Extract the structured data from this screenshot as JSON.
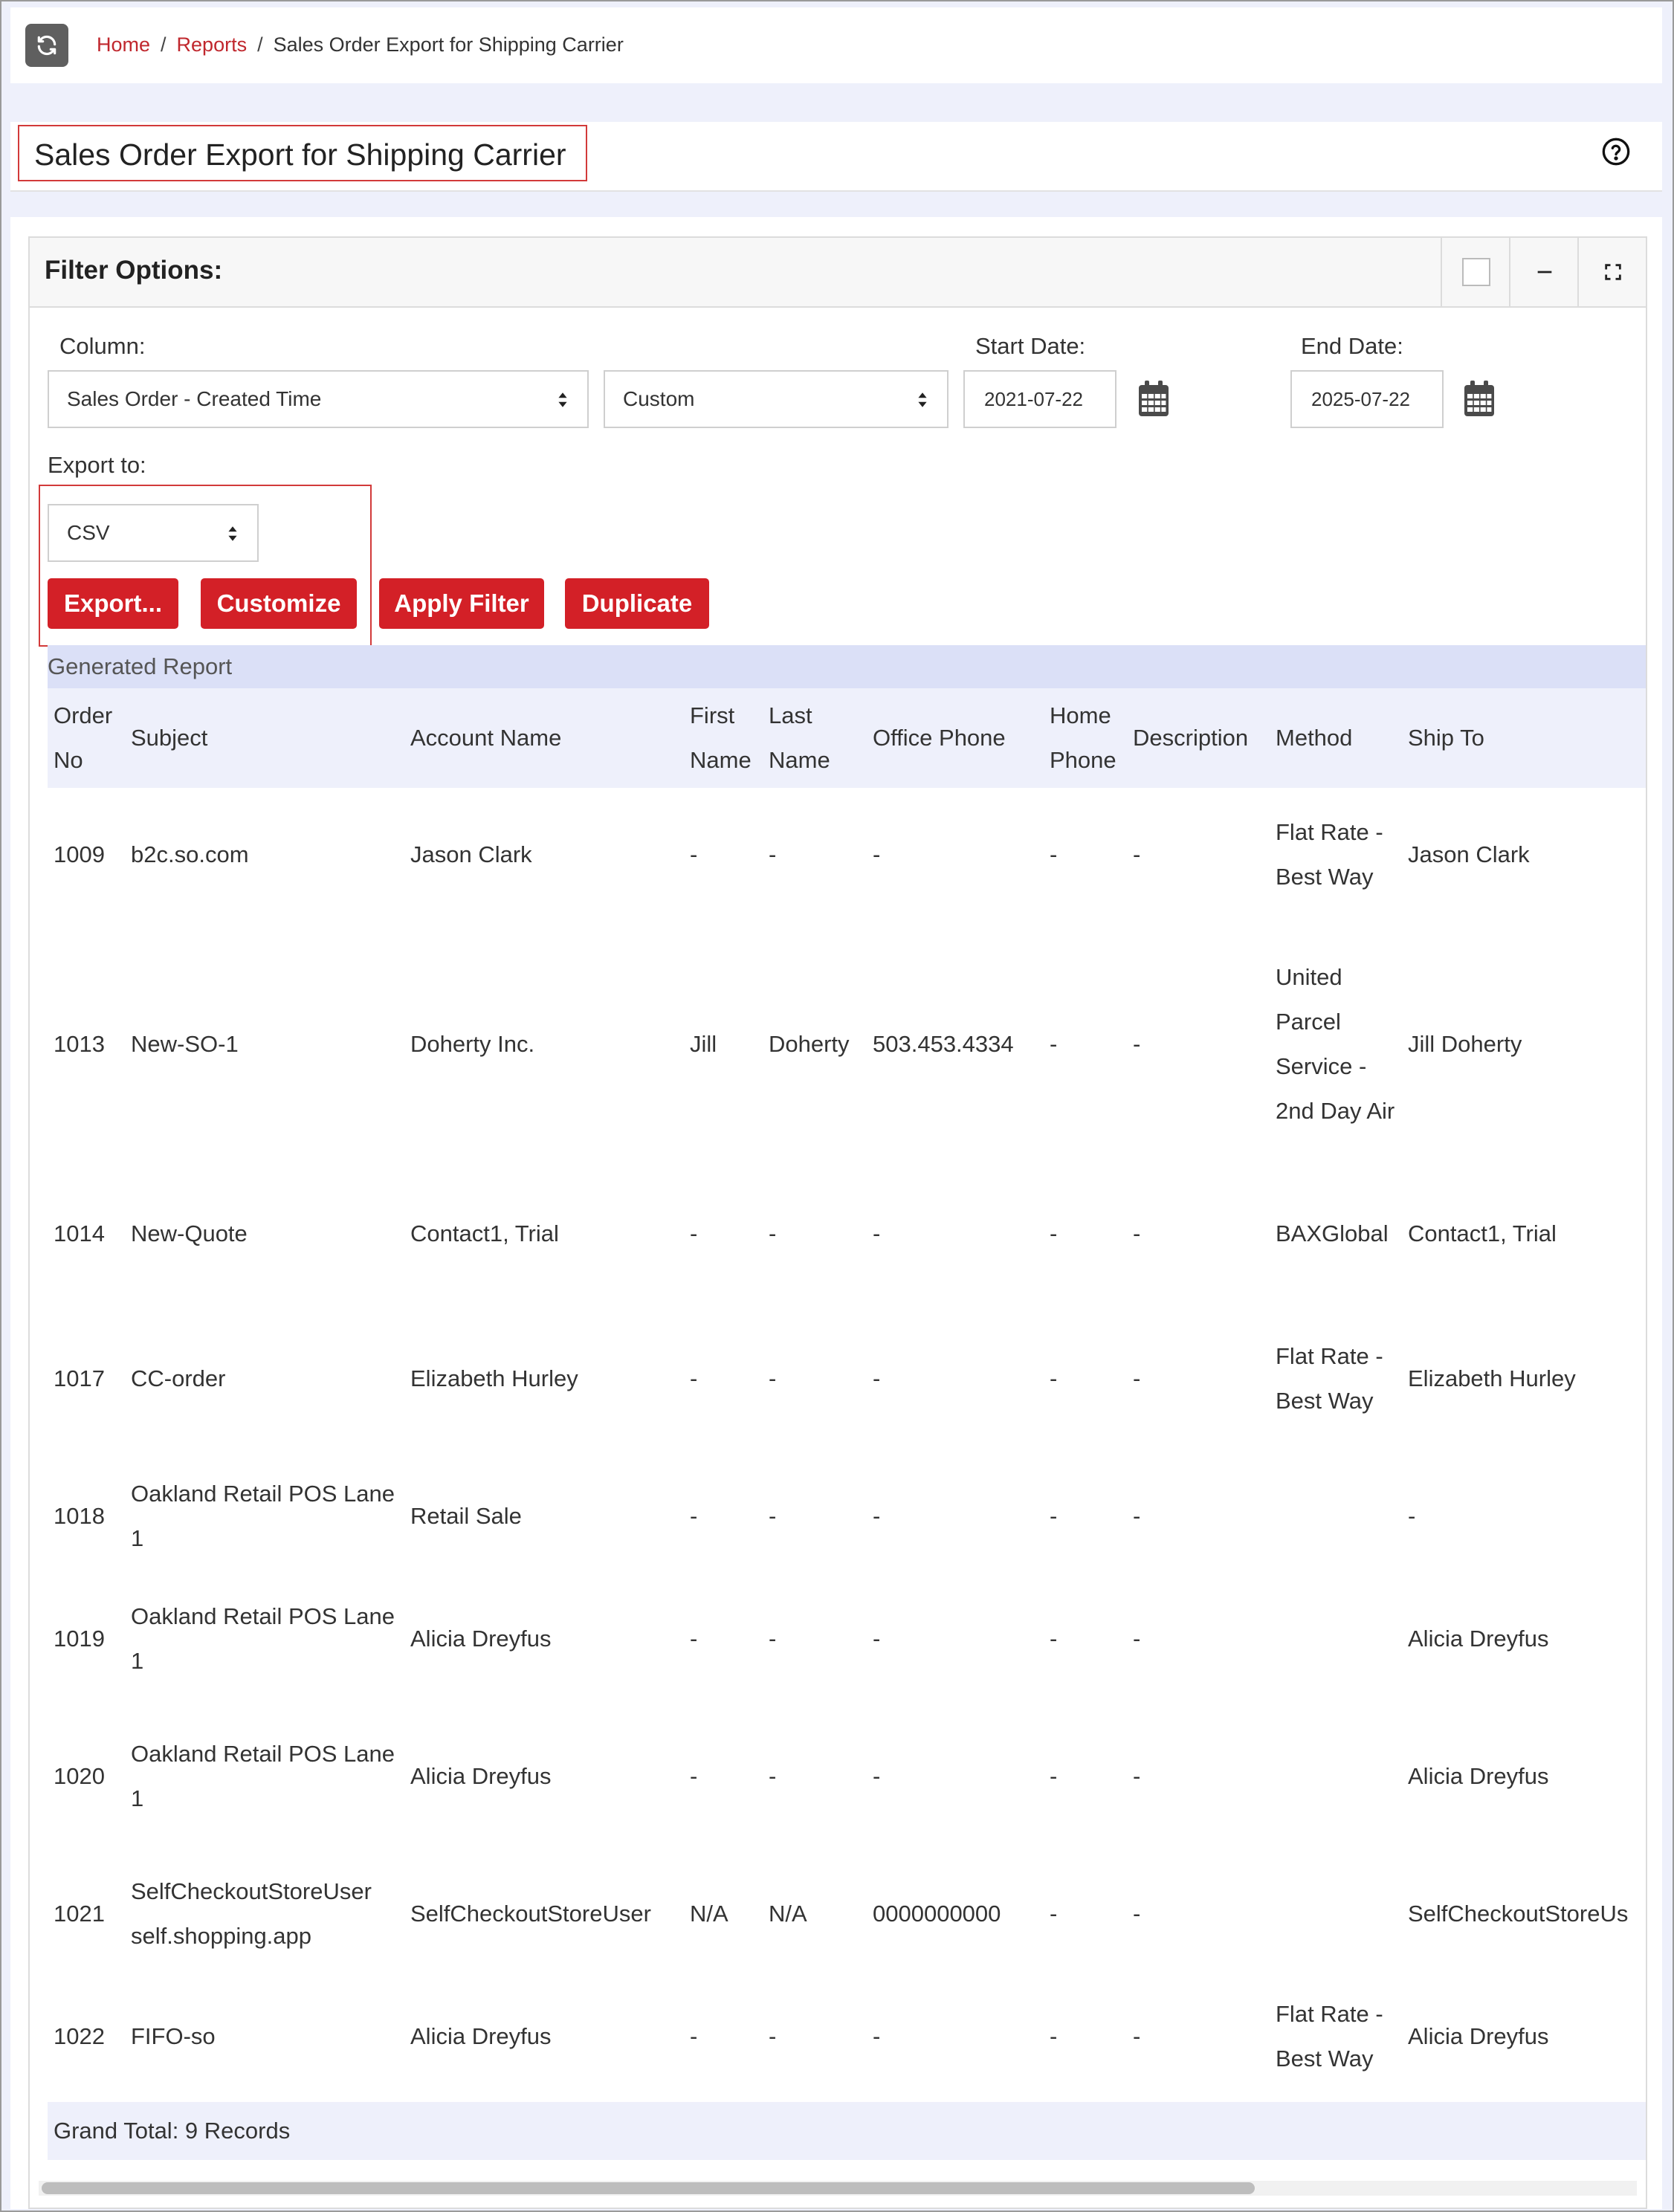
{
  "breadcrumb": {
    "items": [
      "Home",
      "Reports"
    ],
    "current": "Sales Order Export for Shipping Carrier",
    "separator": "/"
  },
  "page": {
    "title": "Sales Order Export for Shipping Carrier"
  },
  "filter_panel": {
    "title": "Filter Options:",
    "column_label": "Column:",
    "column_value": "Sales Order - Created Time",
    "range_value": "Custom",
    "start_label": "Start Date:",
    "start_value": "2021-07-22",
    "end_label": "End Date:",
    "end_value": "2025-07-22",
    "export_label": "Export to:",
    "export_value": "CSV",
    "buttons": {
      "export": "Export...",
      "customize": "Customize",
      "apply": "Apply Filter",
      "duplicate": "Duplicate"
    }
  },
  "report": {
    "section_title": "Generated Report",
    "columns": [
      "Order No",
      "Subject",
      "Account Name",
      "First Name",
      "Last Name",
      "Office Phone",
      "Home Phone",
      "Description",
      "Method",
      "Ship To"
    ],
    "rows": [
      [
        "1009",
        "b2c.so.com",
        "Jason Clark",
        "-",
        "-",
        "-",
        "-",
        "-",
        "Flat Rate - Best Way",
        "Jason Clark"
      ],
      [
        "1013",
        "New-SO-1",
        "Doherty Inc.",
        "Jill",
        "Doherty",
        "503.453.4334",
        "-",
        "-",
        "United Parcel Service - 2nd Day Air",
        "Jill Doherty"
      ],
      [
        "1014",
        "New-Quote",
        "Contact1, Trial",
        "-",
        "-",
        "-",
        "-",
        "-",
        "BAXGlobal",
        "Contact1, Trial"
      ],
      [
        "1017",
        "CC-order",
        "Elizabeth Hurley",
        "-",
        "-",
        "-",
        "-",
        "-",
        "Flat Rate - Best Way",
        "Elizabeth Hurley"
      ],
      [
        "1018",
        "Oakland Retail POS Lane 1",
        "Retail Sale",
        "-",
        "-",
        "-",
        "-",
        "-",
        "",
        "-"
      ],
      [
        "1019",
        "Oakland Retail POS Lane 1",
        "Alicia Dreyfus",
        "-",
        "-",
        "-",
        "-",
        "-",
        "",
        "Alicia Dreyfus"
      ],
      [
        "1020",
        "Oakland Retail POS Lane 1",
        "Alicia Dreyfus",
        "-",
        "-",
        "-",
        "-",
        "-",
        "",
        "Alicia Dreyfus"
      ],
      [
        "1021",
        "SelfCheckoutStoreUser self.shopping.app",
        "SelfCheckoutStoreUser",
        "N/A",
        "N/A",
        "0000000000",
        "-",
        "-",
        "",
        "SelfCheckoutStoreUs"
      ],
      [
        "1022",
        "FIFO-so",
        "Alicia Dreyfus",
        "-",
        "-",
        "-",
        "-",
        "-",
        "Flat Rate - Best Way",
        "Alicia Dreyfus"
      ]
    ],
    "grand_total": "Grand Total: 9 Records"
  },
  "colors": {
    "accent_red": "#d32027",
    "link_red": "#c0272d",
    "header_bg": "#eef0fb",
    "section_bg": "#dbe0f7"
  },
  "icons": [
    "refresh-icon",
    "help-circle-icon",
    "minimize-icon",
    "fullscreen-icon",
    "calendar-icon",
    "select-caret-icon"
  ]
}
